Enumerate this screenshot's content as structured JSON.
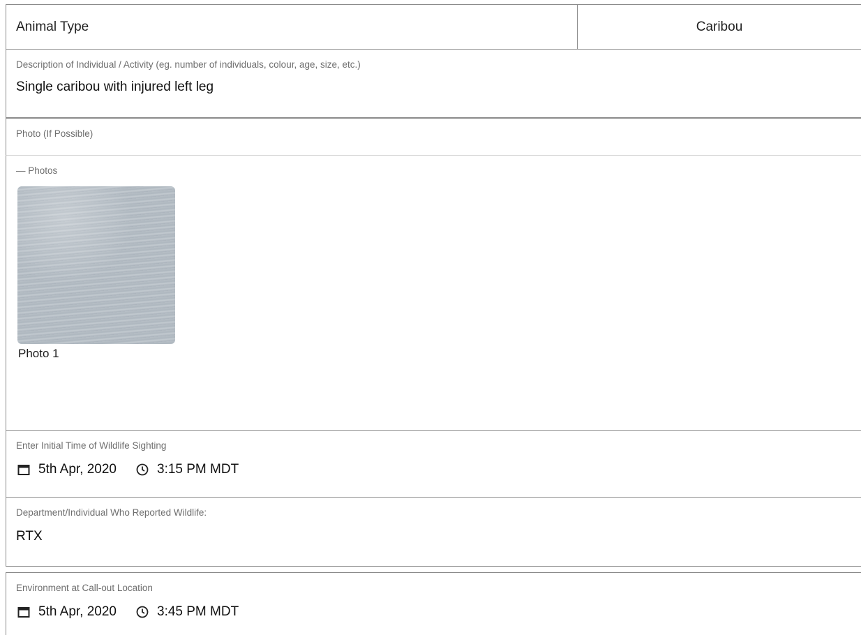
{
  "animal_type": {
    "label": "Animal Type",
    "value": "Caribou"
  },
  "description": {
    "label": "Description of Individual / Activity (eg. number of individuals, colour, age, size, etc.)",
    "value": "Single caribou with injured left leg"
  },
  "photo": {
    "label": "Photo (If Possible)",
    "group_label": "— Photos",
    "items": [
      {
        "caption": "Photo 1"
      }
    ]
  },
  "initial_time": {
    "label": "Enter Initial Time of Wildlife Sighting",
    "date": "5th Apr, 2020",
    "time": "3:15 PM MDT"
  },
  "reporter": {
    "label": "Department/Individual Who Reported Wildlife:",
    "value": "RTX"
  },
  "environment": {
    "label": "Environment at Call-out Location",
    "date": "5th Apr, 2020",
    "time": "3:45 PM MDT"
  },
  "icons": {
    "calendar": "calendar-icon",
    "clock": "clock-icon"
  }
}
